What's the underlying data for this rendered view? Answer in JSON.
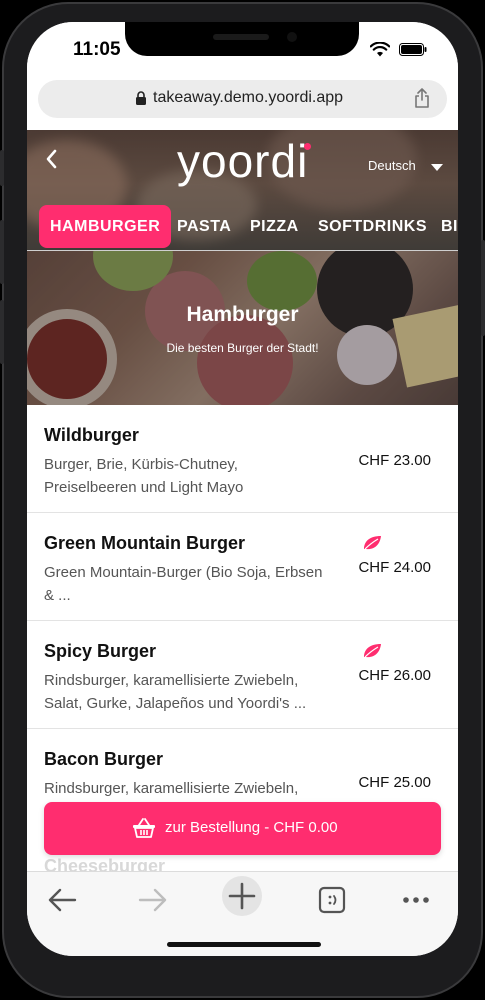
{
  "status_bar": {
    "time": "11:05"
  },
  "browser": {
    "url": "takeaway.demo.yoordi.app"
  },
  "header": {
    "brand": "yoordi",
    "language": "Deutsch"
  },
  "tabs": [
    {
      "label": "HAMBURGER",
      "active": true
    },
    {
      "label": "PASTA",
      "active": false
    },
    {
      "label": "PIZZA",
      "active": false
    },
    {
      "label": "SOFTDRINKS",
      "active": false
    },
    {
      "label": "BI",
      "active": false
    }
  ],
  "category": {
    "title": "Hamburger",
    "subtitle": "Die besten Burger der Stadt!"
  },
  "items": [
    {
      "name": "Wildburger",
      "description": "Burger, Brie, Kürbis-Chutney, Preiselbeeren und Light Mayo",
      "price": "CHF 23.00",
      "vegan": false
    },
    {
      "name": "Green Mountain Burger",
      "description": "Green Mountain-Burger (Bio Soja, Erbsen & ...",
      "price": "CHF 24.00",
      "vegan": true
    },
    {
      "name": "Spicy Burger",
      "description": "Rindsburger, karamellisierte Zwiebeln, Salat, Gurke, Jalapeños und Yoordi's ...",
      "price": "CHF 26.00",
      "vegan": true
    },
    {
      "name": "Bacon Burger",
      "description": "Rindsburger, karamellisierte Zwiebeln,",
      "price": "CHF 25.00",
      "vegan": false
    }
  ],
  "next_item_partial": "Cheeseburger",
  "order_button": {
    "label": "zur Bestellung - CHF 0.00"
  },
  "colors": {
    "accent": "#ff2d6f",
    "leaf": "#ff2d6f"
  },
  "icons": [
    "back-arrow-icon",
    "forward-arrow-icon",
    "plus-icon",
    "tabs-icon",
    "more-icon",
    "basket-icon",
    "leaf-icon",
    "lock-icon",
    "share-icon"
  ]
}
